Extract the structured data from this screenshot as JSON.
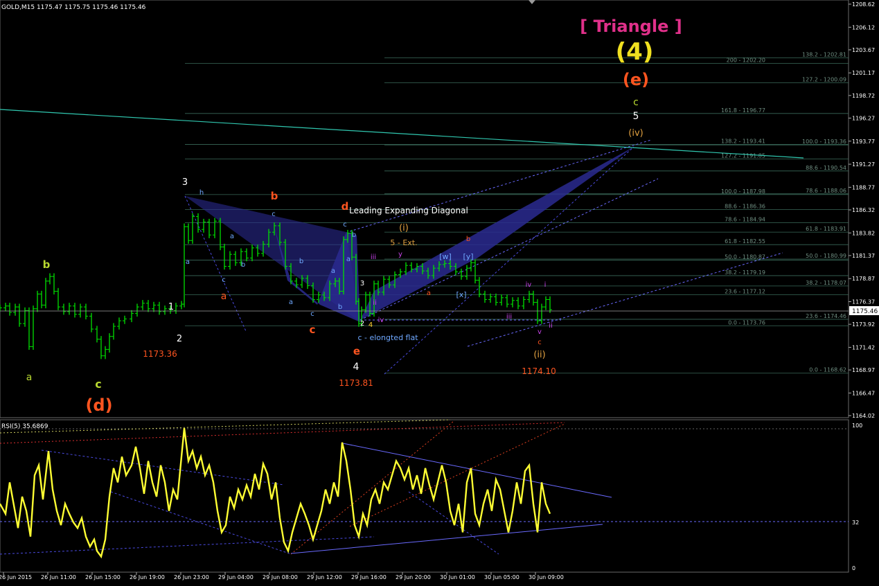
{
  "chart_data": {
    "type": "line",
    "header": "GOLD,M15  1175.47 1175.75 1175.46 1175.46",
    "current_price": "1175.46",
    "price_axis": {
      "ylim": [
        1164.02,
        1208.62
      ],
      "ticks": [
        "1208.62",
        "1206.12",
        "1203.67",
        "1201.17",
        "1198.72",
        "1196.27",
        "1193.77",
        "1191.27",
        "1188.77",
        "1186.32",
        "1183.82",
        "1181.37",
        "1178.87",
        "1176.37",
        "1173.92",
        "1171.42",
        "1168.97",
        "1166.47",
        "1164.02"
      ]
    },
    "time_axis": {
      "labels": [
        "26 Jun 2015",
        "26 Jun 11:00",
        "26 Jun 15:00",
        "26 Jun 19:00",
        "26 Jun 23:00",
        "29 Jun 04:00",
        "29 Jun 08:00",
        "29 Jun 12:00",
        "29 Jun 16:00",
        "29 Jun 20:00",
        "30 Jun 01:00",
        "30 Jun 05:00",
        "30 Jun 09:00"
      ]
    },
    "price_series": {
      "name": "GOLD,M15",
      "color": "#00e000",
      "points": [
        [
          0,
          1175.7
        ],
        [
          8,
          1175.9
        ],
        [
          14,
          1175.2
        ],
        [
          22,
          1175.8
        ],
        [
          28,
          1174.0
        ],
        [
          36,
          1175.4
        ],
        [
          42,
          1171.5
        ],
        [
          48,
          1175.6
        ],
        [
          54,
          1177.2
        ],
        [
          60,
          1176.0
        ],
        [
          66,
          1178.6
        ],
        [
          72,
          1179.1
        ],
        [
          78,
          1177.5
        ],
        [
          84,
          1175.8
        ],
        [
          92,
          1175.3
        ],
        [
          100,
          1175.9
        ],
        [
          108,
          1175.0
        ],
        [
          116,
          1175.8
        ],
        [
          124,
          1174.8
        ],
        [
          132,
          1173.4
        ],
        [
          140,
          1172.3
        ],
        [
          146,
          1170.5
        ],
        [
          152,
          1171.2
        ],
        [
          158,
          1172.6
        ],
        [
          164,
          1173.7
        ],
        [
          172,
          1174.3
        ],
        [
          180,
          1174.5
        ],
        [
          190,
          1175.1
        ],
        [
          198,
          1175.8
        ],
        [
          206,
          1176.2
        ],
        [
          214,
          1175.6
        ],
        [
          222,
          1176.0
        ],
        [
          230,
          1175.3
        ],
        [
          238,
          1175.6
        ],
        [
          246,
          1175.4
        ],
        [
          254,
          1175.9
        ],
        [
          262,
          1176.1
        ],
        [
          266,
          1184.5
        ],
        [
          272,
          1183.0
        ],
        [
          278,
          1185.6
        ],
        [
          286,
          1184.2
        ],
        [
          294,
          1185.0
        ],
        [
          302,
          1183.6
        ],
        [
          310,
          1185.1
        ],
        [
          318,
          1182.3
        ],
        [
          324,
          1180.2
        ],
        [
          332,
          1181.5
        ],
        [
          340,
          1180.6
        ],
        [
          348,
          1181.8
        ],
        [
          356,
          1181.1
        ],
        [
          364,
          1182.2
        ],
        [
          372,
          1181.6
        ],
        [
          380,
          1182.6
        ],
        [
          388,
          1183.9
        ],
        [
          396,
          1184.6
        ],
        [
          404,
          1182.8
        ],
        [
          412,
          1180.2
        ],
        [
          420,
          1178.6
        ],
        [
          428,
          1178.2
        ],
        [
          436,
          1178.9
        ],
        [
          444,
          1178.1
        ],
        [
          452,
          1176.6
        ],
        [
          460,
          1177.1
        ],
        [
          468,
          1176.8
        ],
        [
          476,
          1178.3
        ],
        [
          484,
          1178.6
        ],
        [
          490,
          1177.5
        ],
        [
          496,
          1183.1
        ],
        [
          502,
          1183.8
        ],
        [
          508,
          1181.2
        ],
        [
          514,
          1176.4
        ],
        [
          518,
          1174.0
        ],
        [
          522,
          1175.5
        ],
        [
          528,
          1177.1
        ],
        [
          534,
          1175.1
        ],
        [
          540,
          1178.3
        ],
        [
          546,
          1177.4
        ],
        [
          554,
          1178.8
        ],
        [
          562,
          1178.2
        ],
        [
          570,
          1179.3
        ],
        [
          578,
          1179.6
        ],
        [
          586,
          1180.3
        ],
        [
          594,
          1179.9
        ],
        [
          602,
          1180.2
        ],
        [
          610,
          1179.7
        ],
        [
          618,
          1179.2
        ],
        [
          626,
          1180.0
        ],
        [
          634,
          1180.4
        ],
        [
          642,
          1180.5
        ],
        [
          650,
          1180.2
        ],
        [
          658,
          1179.6
        ],
        [
          666,
          1179.1
        ],
        [
          674,
          1180.0
        ],
        [
          680,
          1180.6
        ],
        [
          686,
          1178.7
        ],
        [
          692,
          1177.2
        ],
        [
          700,
          1176.6
        ],
        [
          708,
          1176.9
        ],
        [
          716,
          1176.3
        ],
        [
          724,
          1176.8
        ],
        [
          732,
          1176.1
        ],
        [
          740,
          1176.5
        ],
        [
          748,
          1175.9
        ],
        [
          756,
          1176.6
        ],
        [
          764,
          1177.2
        ],
        [
          770,
          1176.3
        ],
        [
          776,
          1174.3
        ],
        [
          782,
          1175.8
        ],
        [
          788,
          1176.6
        ],
        [
          794,
          1175.5
        ]
      ]
    },
    "rsi": {
      "label": "RSI(5) 35.6869",
      "scale_labels": [
        "100",
        "32",
        "0"
      ],
      "ylim": [
        0,
        100
      ],
      "color": "#ffff33",
      "points": [
        [
          0,
          45
        ],
        [
          8,
          38
        ],
        [
          14,
          60
        ],
        [
          20,
          44
        ],
        [
          26,
          28
        ],
        [
          32,
          50
        ],
        [
          38,
          40
        ],
        [
          44,
          22
        ],
        [
          50,
          65
        ],
        [
          56,
          72
        ],
        [
          62,
          48
        ],
        [
          70,
          82
        ],
        [
          76,
          55
        ],
        [
          82,
          40
        ],
        [
          88,
          30
        ],
        [
          94,
          45
        ],
        [
          100,
          38
        ],
        [
          106,
          32
        ],
        [
          112,
          28
        ],
        [
          118,
          35
        ],
        [
          124,
          22
        ],
        [
          130,
          15
        ],
        [
          136,
          20
        ],
        [
          140,
          12
        ],
        [
          146,
          8
        ],
        [
          152,
          20
        ],
        [
          158,
          50
        ],
        [
          164,
          70
        ],
        [
          170,
          60
        ],
        [
          176,
          78
        ],
        [
          182,
          65
        ],
        [
          190,
          72
        ],
        [
          196,
          85
        ],
        [
          202,
          70
        ],
        [
          208,
          52
        ],
        [
          214,
          75
        ],
        [
          220,
          60
        ],
        [
          226,
          50
        ],
        [
          232,
          72
        ],
        [
          238,
          60
        ],
        [
          244,
          40
        ],
        [
          250,
          55
        ],
        [
          256,
          48
        ],
        [
          262,
          78
        ],
        [
          266,
          98
        ],
        [
          272,
          75
        ],
        [
          278,
          82
        ],
        [
          284,
          70
        ],
        [
          290,
          78
        ],
        [
          296,
          65
        ],
        [
          302,
          72
        ],
        [
          308,
          60
        ],
        [
          314,
          40
        ],
        [
          320,
          25
        ],
        [
          326,
          30
        ],
        [
          332,
          50
        ],
        [
          338,
          42
        ],
        [
          344,
          55
        ],
        [
          350,
          48
        ],
        [
          356,
          58
        ],
        [
          362,
          50
        ],
        [
          368,
          66
        ],
        [
          374,
          55
        ],
        [
          380,
          73
        ],
        [
          386,
          66
        ],
        [
          392,
          48
        ],
        [
          398,
          60
        ],
        [
          404,
          35
        ],
        [
          410,
          18
        ],
        [
          416,
          12
        ],
        [
          422,
          25
        ],
        [
          428,
          35
        ],
        [
          434,
          45
        ],
        [
          440,
          38
        ],
        [
          446,
          30
        ],
        [
          452,
          20
        ],
        [
          458,
          30
        ],
        [
          464,
          40
        ],
        [
          470,
          55
        ],
        [
          476,
          45
        ],
        [
          482,
          60
        ],
        [
          488,
          50
        ],
        [
          494,
          88
        ],
        [
          500,
          75
        ],
        [
          506,
          55
        ],
        [
          512,
          30
        ],
        [
          518,
          22
        ],
        [
          524,
          38
        ],
        [
          530,
          30
        ],
        [
          536,
          48
        ],
        [
          542,
          55
        ],
        [
          548,
          45
        ],
        [
          554,
          60
        ],
        [
          560,
          55
        ],
        [
          566,
          65
        ],
        [
          572,
          75
        ],
        [
          578,
          70
        ],
        [
          584,
          62
        ],
        [
          590,
          70
        ],
        [
          596,
          55
        ],
        [
          602,
          65
        ],
        [
          608,
          52
        ],
        [
          614,
          70
        ],
        [
          620,
          58
        ],
        [
          626,
          48
        ],
        [
          632,
          60
        ],
        [
          638,
          72
        ],
        [
          644,
          60
        ],
        [
          650,
          40
        ],
        [
          656,
          30
        ],
        [
          662,
          45
        ],
        [
          668,
          25
        ],
        [
          674,
          60
        ],
        [
          680,
          70
        ],
        [
          686,
          38
        ],
        [
          692,
          30
        ],
        [
          698,
          45
        ],
        [
          704,
          55
        ],
        [
          710,
          40
        ],
        [
          716,
          62
        ],
        [
          722,
          55
        ],
        [
          728,
          40
        ],
        [
          734,
          25
        ],
        [
          740,
          40
        ],
        [
          746,
          60
        ],
        [
          752,
          45
        ],
        [
          758,
          68
        ],
        [
          764,
          72
        ],
        [
          770,
          45
        ],
        [
          776,
          25
        ],
        [
          782,
          60
        ],
        [
          788,
          45
        ],
        [
          794,
          38
        ]
      ]
    },
    "fib_labels": [
      {
        "text": "200 - 1202.20",
        "level": 1202.2
      },
      {
        "text": "138.2 - 1202.81",
        "level": 1202.81
      },
      {
        "text": "127.2 - 1200.09",
        "level": 1200.09
      },
      {
        "text": "161.8 - 1196.77",
        "level": 1196.77
      },
      {
        "text": "138.2 - 1193.41",
        "level": 1193.41
      },
      {
        "text": "100.0 - 1193.36",
        "level": 1193.36
      },
      {
        "text": "127.2 - 1191.85",
        "level": 1191.85
      },
      {
        "text": "88.6 - 1190.54",
        "level": 1190.54
      },
      {
        "text": "100.0 - 1187.98",
        "level": 1187.98
      },
      {
        "text": "78.6 - 1188.06",
        "level": 1188.06
      },
      {
        "text": "88.6 - 1186.36",
        "level": 1186.36
      },
      {
        "text": "78.6 - 1184.94",
        "level": 1184.94
      },
      {
        "text": "61.8 - 1183.91",
        "level": 1183.91
      },
      {
        "text": "61.8 - 1182.55",
        "level": 1182.55
      },
      {
        "text": "50.0 - 1180.87",
        "level": 1180.87
      },
      {
        "text": "50.0 - 1180.99",
        "level": 1180.99
      },
      {
        "text": "38.2 - 1179.19",
        "level": 1179.19
      },
      {
        "text": "38.2 - 1178.07",
        "level": 1178.07
      },
      {
        "text": "23.6 - 1177.12",
        "level": 1177.12
      },
      {
        "text": "23.6 - 1174.46",
        "level": 1174.46
      },
      {
        "text": "0.0 - 1173.76",
        "level": 1173.76
      },
      {
        "text": "0.0 - 1168.62",
        "level": 1168.62
      }
    ],
    "annotations": [
      {
        "text": "[ Triangle ]",
        "color": "#e0308a"
      },
      {
        "text": "(4)",
        "color": "#f0e020"
      },
      {
        "text": "(e)",
        "color": "#ff5520"
      },
      {
        "text": "c",
        "color": "#b8d830"
      },
      {
        "text": "5",
        "color": "#ffffff"
      },
      {
        "text": "(iv)",
        "color": "#e0a040"
      },
      {
        "text": "Leading Expanding Diagonal",
        "color": "#ffffff"
      },
      {
        "text": "(i)",
        "color": "#e0a040"
      },
      {
        "text": "5 - Ext.",
        "color": "#e0a040"
      },
      {
        "text": "c - elongted flat",
        "color": "#6fa8ff"
      },
      {
        "text": "1173.36",
        "color": "#ff5520"
      },
      {
        "text": "1173.81",
        "color": "#ff5520"
      },
      {
        "text": "1174.10",
        "color": "#ff5520"
      },
      {
        "text": "(d)",
        "color": "#ff5520"
      },
      {
        "text": "(ii)",
        "color": "#e0a040"
      },
      {
        "text": "a",
        "color": "#b8d830"
      },
      {
        "text": "b",
        "color": "#b8d830"
      },
      {
        "text": "c",
        "color": "#b8d830"
      },
      {
        "text": "1",
        "color": "#ffffff"
      },
      {
        "text": "2",
        "color": "#ffffff"
      },
      {
        "text": "3",
        "color": "#ffffff"
      },
      {
        "text": "4",
        "color": "#ffffff"
      },
      {
        "text": "a",
        "color": "#ff5520"
      },
      {
        "text": "b",
        "color": "#ff5520"
      },
      {
        "text": "c",
        "color": "#ff5520"
      },
      {
        "text": "d",
        "color": "#ff5520"
      },
      {
        "text": "e",
        "color": "#ff5520"
      },
      {
        "text": "[w]",
        "color": "#6fa8ff"
      },
      {
        "text": "[y]",
        "color": "#6fa8ff"
      },
      {
        "text": "[x]",
        "color": "#6fa8ff"
      },
      {
        "text": "iii",
        "color": "#cc44ee"
      },
      {
        "text": "iv",
        "color": "#cc44ee"
      },
      {
        "text": "v",
        "color": "#cc44ee"
      },
      {
        "text": "i",
        "color": "#cc44ee"
      },
      {
        "text": "ii",
        "color": "#cc44ee"
      }
    ]
  }
}
